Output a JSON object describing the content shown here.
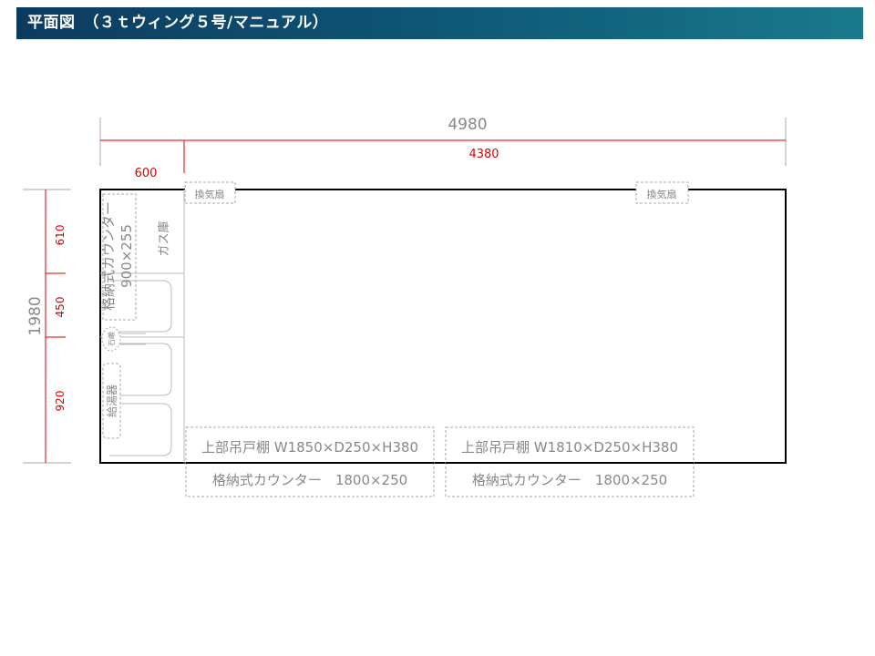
{
  "header": {
    "title": "平面図　（３ｔウィング５号/マニュアル）"
  },
  "colors": {
    "header_bg": "#0d3b5f",
    "dimension_red": "#e00000",
    "outline": "#000000",
    "dim_gray": "#999999"
  },
  "dimensions": {
    "total_width": "4980",
    "inner_width": "4380",
    "left_width": "600",
    "total_depth": "1980",
    "seg1": "610",
    "seg2": "450",
    "seg3": "920"
  },
  "fixtures": {
    "fan_left": "換気扇",
    "fan_right": "換気扇",
    "left_counter_name": "格納式カウンター",
    "left_counter_size": "900×255",
    "gas": "ガス庫",
    "stone": "石鹸",
    "heater": "給湯器"
  },
  "cabinets": {
    "upper_left": "上部吊戸棚 W1850×D250×H380",
    "upper_right": "上部吊戸棚 W1810×D250×H380",
    "counter_left": "格納式カウンター　1800×250",
    "counter_right": "格納式カウンター　1800×250"
  }
}
